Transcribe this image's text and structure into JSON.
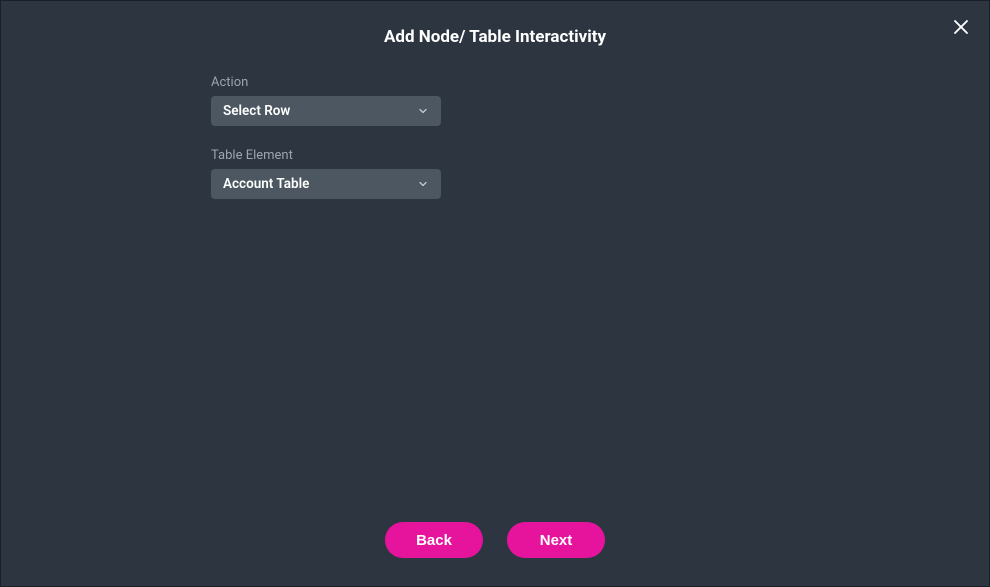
{
  "modal": {
    "title": "Add Node/ Table Interactivity"
  },
  "form": {
    "action": {
      "label": "Action",
      "value": "Select Row"
    },
    "tableElement": {
      "label": "Table Element",
      "value": "Account Table"
    }
  },
  "footer": {
    "back": "Back",
    "next": "Next"
  },
  "colors": {
    "accent": "#E6149C",
    "background": "#2C3540",
    "selectBg": "#4C5761"
  }
}
